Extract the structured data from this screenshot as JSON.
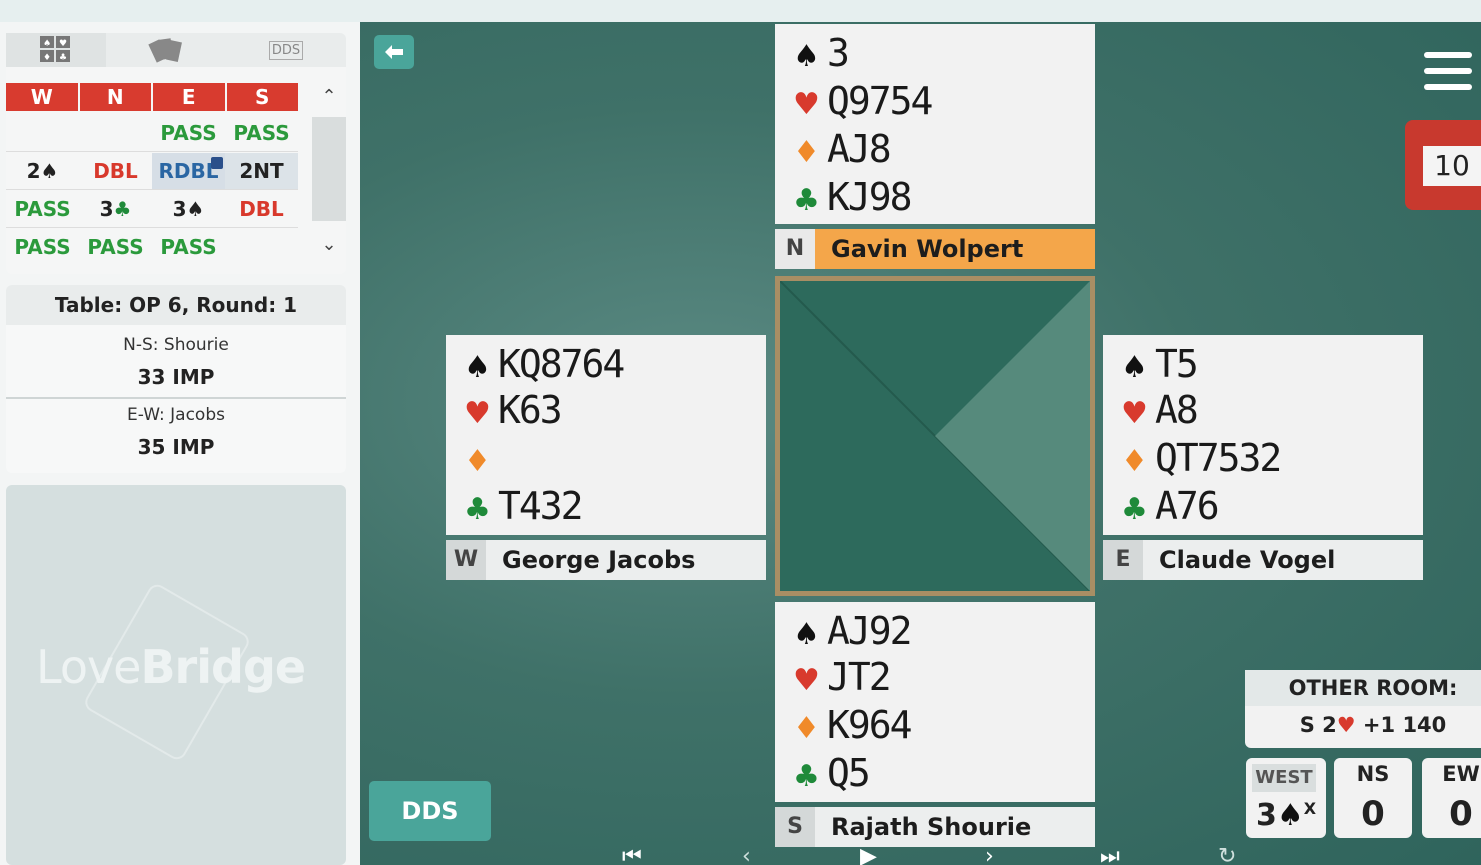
{
  "tabs": {
    "dds_label": "DDS"
  },
  "bidding": {
    "headers": [
      "W",
      "N",
      "E",
      "S"
    ],
    "rows": [
      [
        "",
        "",
        "PASS",
        "PASS"
      ],
      [
        "2♠",
        "DBL",
        "RDBL",
        "2NT"
      ],
      [
        "PASS",
        "3♣",
        "3♠",
        "DBL"
      ],
      [
        "PASS",
        "PASS",
        "PASS",
        ""
      ]
    ]
  },
  "info": {
    "title": "Table: OP 6, Round: 1",
    "ns_label": "N-S: Shourie",
    "ns_score": "33 IMP",
    "ew_label": "E-W: Jacobs",
    "ew_score": "35 IMP"
  },
  "logo": {
    "light": "Love",
    "bold": "Bridge"
  },
  "board_number": "10",
  "hands": {
    "north": {
      "seat": "N",
      "name": "Gavin Wolpert",
      "spades": "3",
      "hearts": "Q9754",
      "diamonds": "AJ8",
      "clubs": "KJ98"
    },
    "west": {
      "seat": "W",
      "name": "George Jacobs",
      "spades": "KQ8764",
      "hearts": "K63",
      "diamonds": "",
      "clubs": "T432"
    },
    "east": {
      "seat": "E",
      "name": "Claude Vogel",
      "spades": "T5",
      "hearts": "A8",
      "diamonds": "QT7532",
      "clubs": "A76"
    },
    "south": {
      "seat": "S",
      "name": "Rajath Shourie",
      "spades": "AJ92",
      "hearts": "JT2",
      "diamonds": "K964",
      "clubs": "Q5"
    }
  },
  "other_room": {
    "label": "OTHER ROOM:",
    "contract_prefix": "S 2",
    "result": "+1 140"
  },
  "contract": {
    "declarer": "WEST",
    "level": "3",
    "doubled": "X"
  },
  "scores": {
    "ns_label": "NS",
    "ns_value": "0",
    "ew_label": "EW",
    "ew_value": "0"
  },
  "dds_button": "DDS",
  "colors": {
    "felt": "#3f7168",
    "accent": "#4aa59a",
    "bid_header": "#d83b2f",
    "pass": "#2b9a3c",
    "dbl": "#d8392c",
    "north_plate": "#f4a64a"
  }
}
